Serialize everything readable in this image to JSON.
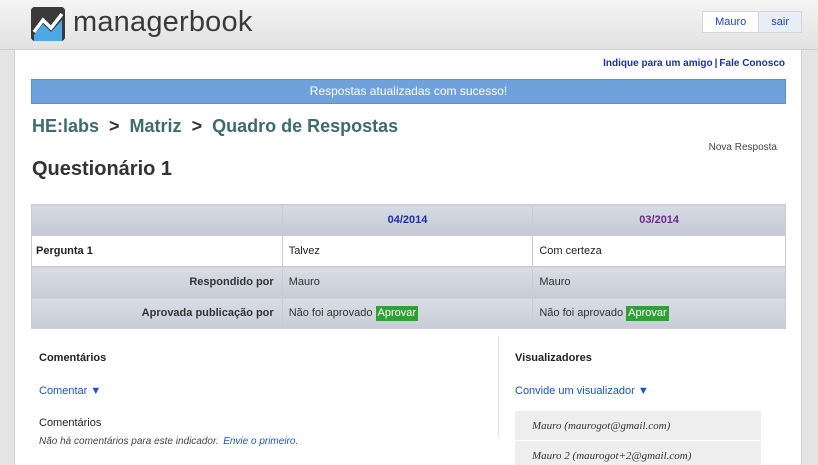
{
  "brand": {
    "name": "managerbook"
  },
  "user": {
    "name": "Mauro",
    "logout": "sair"
  },
  "toplinks": {
    "invite": "Indique para um amigo",
    "separator": "|",
    "contact": "Fale Conosco"
  },
  "flash": "Respostas atualizadas com sucesso!",
  "breadcrumb": {
    "items": [
      "HE:labs",
      "Matriz",
      "Quadro de Respostas"
    ],
    "separator": ">"
  },
  "actions": {
    "new_response": "Nova Resposta"
  },
  "page_title": "Questionário 1",
  "table": {
    "columns": [
      "04/2014",
      "03/2014"
    ],
    "rows": {
      "question": {
        "label": "Pergunta 1",
        "values": [
          "Talvez",
          "Com certeza"
        ]
      },
      "answered_by": {
        "label": "Respondido por",
        "values": [
          "Mauro",
          "Mauro"
        ]
      },
      "approval": {
        "label": "Aprovada publicação por",
        "values": [
          "Não foi aprovado",
          "Não foi aprovado"
        ],
        "button": "Aprovar"
      }
    }
  },
  "comments": {
    "title": "Comentários",
    "action": "Comentar ▼",
    "subtitle": "Comentários",
    "empty": "Não há comentários para este indicador.",
    "first_link": "Envie o primeiro."
  },
  "viewers": {
    "title": "Visualizadores",
    "action": "Convide um visualizador ▼",
    "list": [
      "Mauro (maurogot@gmail.com)",
      "Mauro 2 (maurogot+2@gmail.com)"
    ]
  },
  "colors": {
    "flash_bg": "#6fa2dc",
    "approve_bg": "#2ea135",
    "header_link": "#1a2fa8",
    "breadcrumb": "#3d6b6e"
  }
}
